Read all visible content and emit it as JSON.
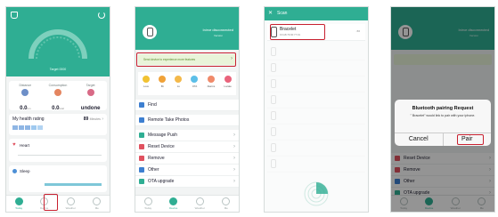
{
  "screen1": {
    "target_label": "Target 0000",
    "stats": [
      {
        "label": "Distance",
        "value": "0.0",
        "unit": "km"
      },
      {
        "label": "Consumption",
        "value": "0.0",
        "unit": "kcal"
      },
      {
        "label": "Target",
        "value": "undone",
        "unit": ""
      }
    ],
    "health_title": "My health rating",
    "health_score": "89",
    "health_unit": "Minutes",
    "heart_label": "Heart",
    "sleep_label": "Sleep",
    "tabs": [
      "Today",
      "Device",
      "Weather",
      "Me"
    ]
  },
  "screen2": {
    "device_name": "Inirve disconnected",
    "device_sub": "Version",
    "banner_text": "Send device to experience more features",
    "quick": [
      "Love",
      "Bt",
      "Ls",
      "OTA",
      "Alarms",
      "Locate"
    ],
    "rows": [
      "Find",
      "Remote Take Photos",
      "Message Push",
      "Reset Device",
      "Remove",
      "Other",
      "OTA upgrade"
    ]
  },
  "screen3": {
    "title": "Scan",
    "close_glyph": "✕",
    "device_name": "Bracelet",
    "device_mac": "F0:A8:79:00:77:01",
    "device_rssi": "-56"
  },
  "screen4": {
    "dialog_title": "Bluetooth pairing Request",
    "dialog_body": "\" Bracelet\" would link to pair with your iphone.",
    "cancel_label": "Cancel",
    "pair_label": "Pair",
    "rows": [
      "Reset Device",
      "Remove",
      "Other",
      "OTA upgrade"
    ]
  },
  "colors": {
    "accent": "#2fae93",
    "highlight": "#c8202f"
  }
}
